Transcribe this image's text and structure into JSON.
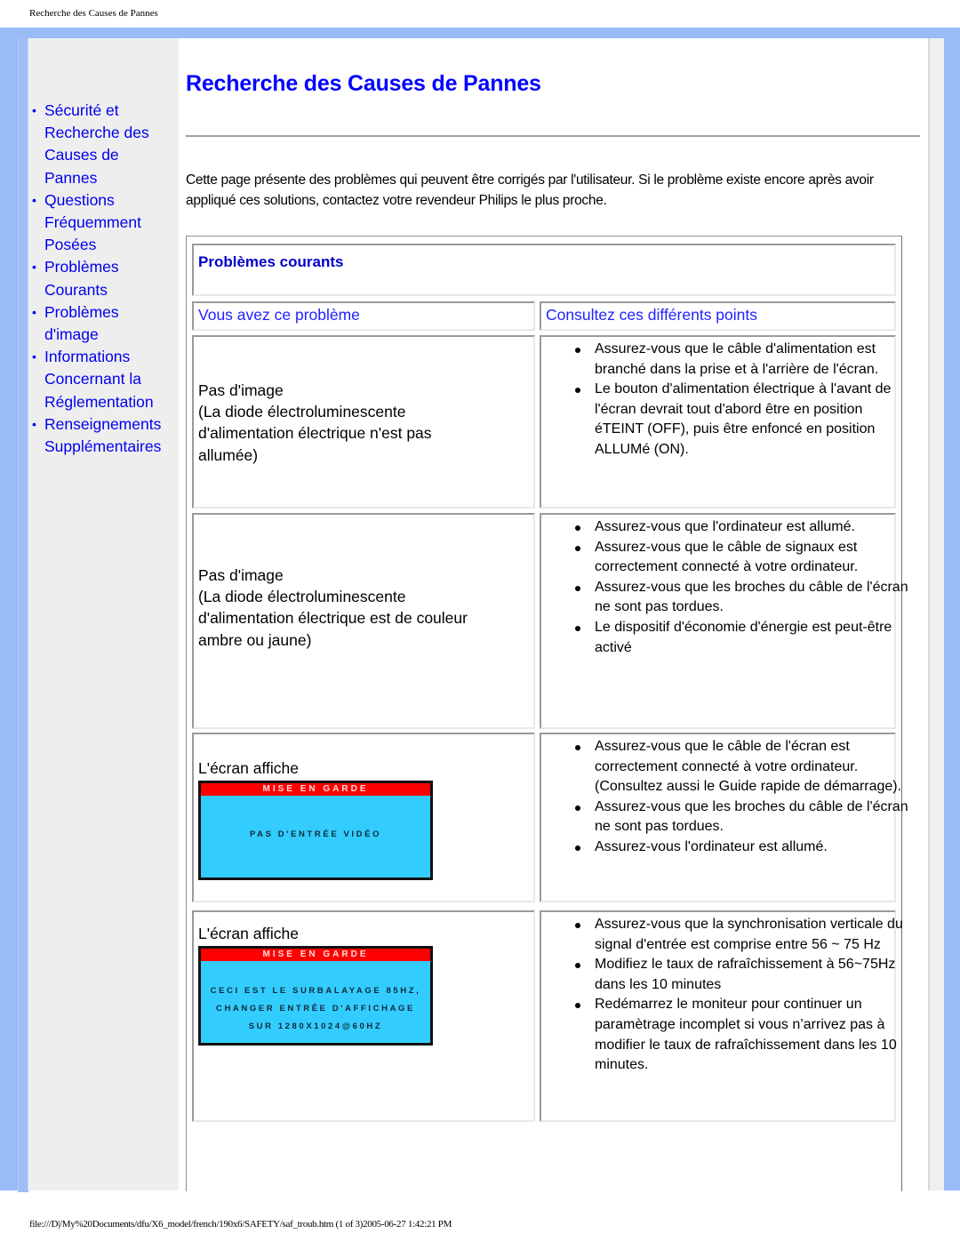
{
  "print_header": "Recherche des Causes de Pannes",
  "print_footer": "file:///D|/My%20Documents/dfu/X6_model/french/190x6/SAFETY/saf_troub.htm (1 of 3)2005-06-27 1:42:21 PM",
  "colors": {
    "frame": "#99bbf7",
    "sidebar": "#eeeeee",
    "link": "#0000ee",
    "title": "#0000ff",
    "osd_header": "#ff0000",
    "osd_body": "#33ccff"
  },
  "sidebar": {
    "items": [
      {
        "label": "Sécurité et Recherche des Causes de Pannes",
        "lines": [
          "Sécurité et",
          "Recherche des",
          "Causes de",
          "Pannes"
        ]
      },
      {
        "label": "Questions Fréquemment Posées",
        "lines": [
          "Questions",
          "Fréquemment",
          "Posées"
        ]
      },
      {
        "label": "Problèmes Courants",
        "lines": [
          "Problèmes",
          "Courants"
        ]
      },
      {
        "label": "Problèmes d'image",
        "lines": [
          "Problèmes",
          "d'image"
        ]
      },
      {
        "label": "Informations Concernant la Réglementation",
        "lines": [
          "Informations",
          "Concernant la",
          "Réglementation"
        ]
      },
      {
        "label": "Renseignements Supplémentaires",
        "lines": [
          "Renseignements",
          "Supplémentaires"
        ]
      }
    ],
    "bullet": "•"
  },
  "main": {
    "title": "Recherche des Causes de Pannes",
    "intro": "Cette page présente des problèmes qui peuvent être corrigés par l'utilisateur. Si le problème existe encore après avoir appliqué ces solutions, contactez votre revendeur Philips le plus proche.",
    "section_title": "Problèmes courants",
    "col_problem": "Vous avez ce problème",
    "col_checks": "Consultez ces différents points",
    "rows": [
      {
        "problem_lines": [
          "Pas d'image",
          "(La diode électroluminescente",
          "d'alimentation électrique n'est pas",
          "allumée)"
        ],
        "checks": [
          "Assurez-vous que le câble d'alimentation est branché dans la prise et à l'arrière de l'écran.",
          "Le bouton d'alimentation électrique à l'avant de l'écran devrait tout d'abord être en position éTEINT (OFF), puis être enfoncé en position ALLUMé (ON)."
        ]
      },
      {
        "problem_lines": [
          "Pas d'image",
          "(La diode électroluminescente",
          "d'alimentation électrique est de couleur",
          "ambre ou jaune)"
        ],
        "checks": [
          "Assurez-vous que l'ordinateur est allumé.",
          "Assurez-vous que le câble de signaux est correctement connecté à votre ordinateur.",
          "Assurez-vous que les broches du câble de l'écran ne sont pas tordues.",
          "Le dispositif d'économie d'énergie est peut-être activé"
        ]
      },
      {
        "problem_lines": [
          "L'écran affiche"
        ],
        "osd": {
          "header": "MISE EN GARDE",
          "message_lines": [
            "PAS D'ENTRÉE VIDÉO"
          ]
        },
        "checks": [
          "Assurez-vous que le câble de l'écran est correctement connecté à votre ordinateur. (Consultez aussi le Guide rapide de démarrage).",
          "Assurez-vous que les broches du câble de l'écran ne sont pas tordues.",
          "Assurez-vous l'ordinateur est allumé."
        ]
      },
      {
        "problem_lines": [
          "L'écran affiche"
        ],
        "osd": {
          "header": "MISE EN GARDE",
          "message_lines": [
            "CECI EST LE SURBALAYAGE 85HZ,",
            "CHANGER ENTRÊE D'AFFICHAGE",
            "SUR 1280X1024@60HZ"
          ]
        },
        "checks": [
          "Assurez-vous que la synchronisation verticale du signal d'entrée est comprise entre 56 ~ 75 Hz",
          "Modifiez le taux de rafraîchissement à 56~75Hz dans les 10 minutes",
          "Redémarrez le moniteur pour continuer un paramètrage incomplet si vous n’arrivez pas à modifier le taux de rafraîchissement dans les 10 minutes."
        ]
      }
    ]
  }
}
